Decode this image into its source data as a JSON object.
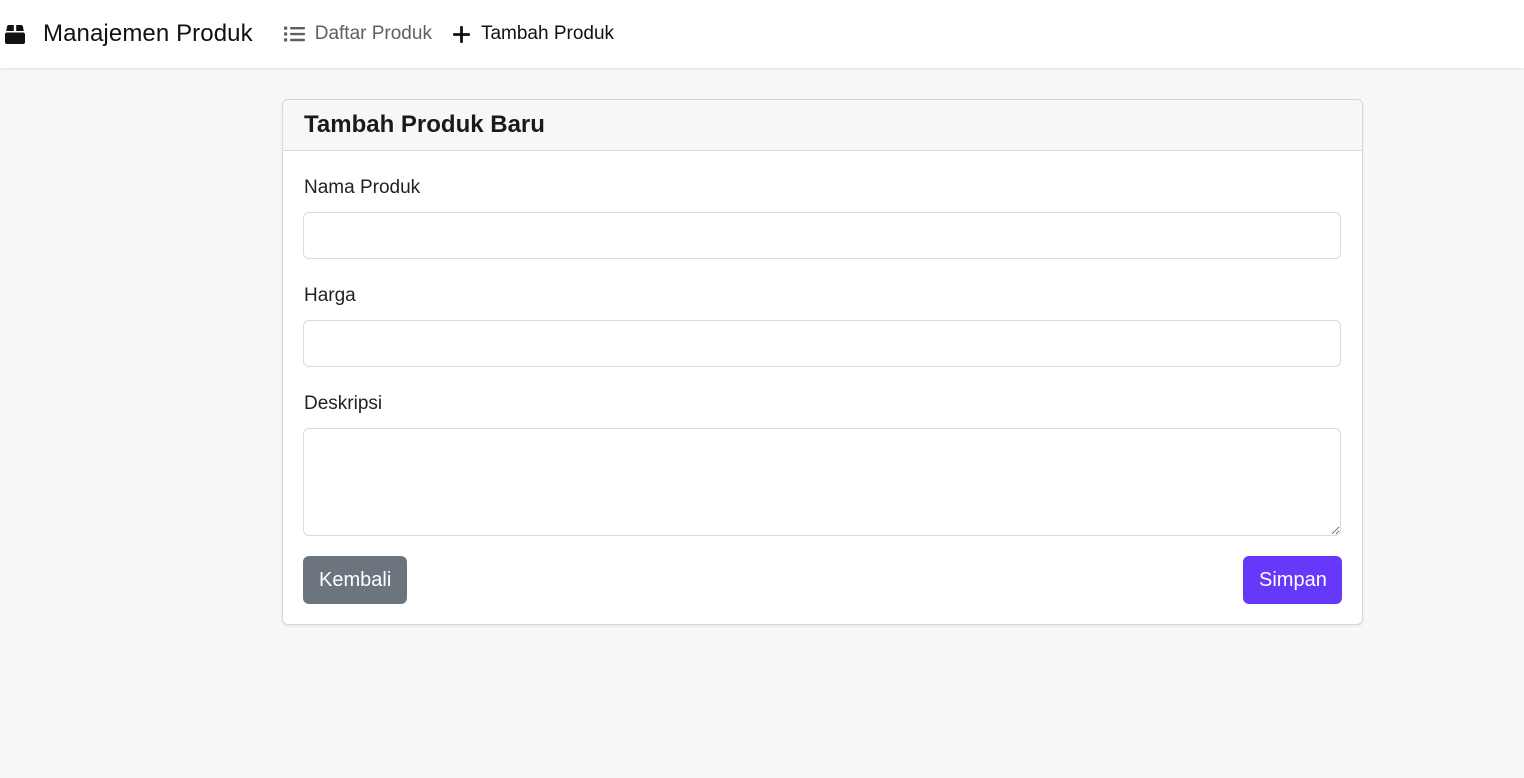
{
  "navbar": {
    "brand": "Manajemen Produk",
    "brand_icon": "box-icon",
    "links": [
      {
        "label": "Daftar Produk",
        "icon": "list-icon"
      },
      {
        "label": "Tambah Produk",
        "icon": "plus-icon"
      }
    ]
  },
  "form": {
    "title": "Tambah Produk Baru",
    "fields": {
      "name": {
        "label": "Nama Produk",
        "value": ""
      },
      "price": {
        "label": "Harga",
        "value": ""
      },
      "description": {
        "label": "Deskripsi",
        "value": ""
      }
    },
    "back_label": "Kembali",
    "save_label": "Simpan"
  },
  "colors": {
    "page_background": "#f7f8fa",
    "primary_button": "#6538fa",
    "secondary_button": "#6c757d"
  }
}
